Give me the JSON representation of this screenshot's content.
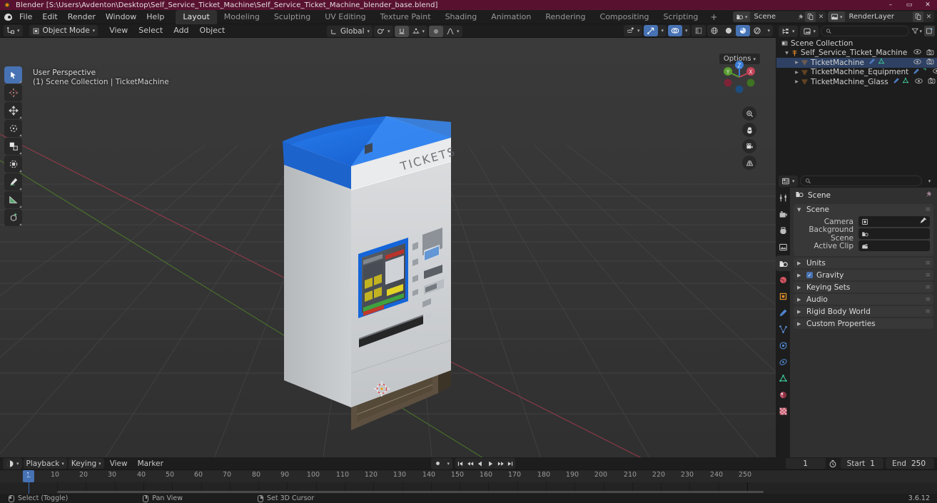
{
  "titlebar": {
    "title": "Blender [S:\\Users\\Avdenton\\Desktop\\Self_Service_Ticket_Machine\\Self_Service_Ticket_Machine_blender_base.blend]",
    "minimize": "–",
    "maximize": "▭",
    "close": "✕"
  },
  "menu": {
    "items": [
      "File",
      "Edit",
      "Render",
      "Window",
      "Help"
    ],
    "workspaces": [
      {
        "label": "Layout",
        "active": true
      },
      {
        "label": "Modeling",
        "active": false
      },
      {
        "label": "Sculpting",
        "active": false
      },
      {
        "label": "UV Editing",
        "active": false
      },
      {
        "label": "Texture Paint",
        "active": false
      },
      {
        "label": "Shading",
        "active": false
      },
      {
        "label": "Animation",
        "active": false
      },
      {
        "label": "Rendering",
        "active": false
      },
      {
        "label": "Compositing",
        "active": false
      },
      {
        "label": "Scripting",
        "active": false
      }
    ],
    "add_workspace": "+",
    "scene_name": "Scene",
    "viewlayer_name": "RenderLayer"
  },
  "viewport": {
    "mode": "Object Mode",
    "menus": [
      "View",
      "Select",
      "Add",
      "Object"
    ],
    "transform_orientation": "Global",
    "overlay_text_line1": "User Perspective",
    "overlay_text_line2": "(1) Scene Collection | TicketMachine",
    "options_label": "Options",
    "gizmo_axes": {
      "x": "X",
      "y": "Y",
      "z": "Z"
    },
    "shading_modes": [
      "wireframe",
      "solid",
      "material-preview",
      "rendered"
    ],
    "active_shading": "material-preview",
    "tools": [
      {
        "name": "tweak-tool",
        "active": true
      },
      {
        "name": "cursor-tool",
        "active": false
      },
      {
        "name": "move-tool",
        "active": false
      },
      {
        "name": "rotate-tool",
        "active": false
      },
      {
        "name": "scale-tool",
        "active": false
      },
      {
        "name": "transform-tool",
        "active": false
      },
      {
        "name": "annotate-tool",
        "active": false
      },
      {
        "name": "measure-tool",
        "active": false
      },
      {
        "name": "add-cube-tool",
        "active": false
      }
    ],
    "nav_buttons": [
      "zoom-icon",
      "pan-hand-icon",
      "camera-icon",
      "perspective-grid-icon"
    ]
  },
  "outliner": {
    "search_placeholder": "",
    "root": "Scene Collection",
    "items": [
      {
        "label": "Self_Service_Ticket_Machine",
        "level": 0,
        "icon": "collection-icon",
        "selected": false,
        "expanded": true,
        "mods": []
      },
      {
        "label": "TicketMachine",
        "level": 1,
        "icon": "mesh-icon",
        "selected": true,
        "expanded": false,
        "mods": [
          "modifier-icon",
          "mesh-data-icon"
        ]
      },
      {
        "label": "TicketMachine_Equipment",
        "level": 1,
        "icon": "mesh-icon",
        "selected": false,
        "expanded": false,
        "mods": [
          "modifier-icon",
          "more-icon"
        ]
      },
      {
        "label": "TicketMachine_Glass",
        "level": 1,
        "icon": "mesh-icon",
        "selected": false,
        "expanded": false,
        "mods": [
          "modifier-icon",
          "mesh-data-icon"
        ]
      }
    ]
  },
  "properties": {
    "search_placeholder": "",
    "breadcrumb": "Scene",
    "tabs": [
      {
        "name": "tool-tab",
        "active": false
      },
      {
        "name": "render-tab",
        "active": false
      },
      {
        "name": "output-tab",
        "active": false
      },
      {
        "name": "view-layer-tab",
        "active": false
      },
      {
        "name": "scene-tab",
        "active": true
      },
      {
        "name": "world-tab",
        "active": false
      },
      {
        "name": "object-tab",
        "active": false
      },
      {
        "name": "modifier-tab",
        "active": false
      },
      {
        "name": "particles-tab",
        "active": false
      },
      {
        "name": "physics-tab",
        "active": false
      },
      {
        "name": "constraints-tab",
        "active": false
      },
      {
        "name": "object-data-tab",
        "active": false
      },
      {
        "name": "material-tab",
        "active": false
      },
      {
        "name": "texture-tab",
        "active": false
      }
    ],
    "panels": [
      {
        "label": "Scene",
        "open": true,
        "checkbox": null
      },
      {
        "label": "Units",
        "open": false,
        "checkbox": null
      },
      {
        "label": "Gravity",
        "open": false,
        "checkbox": true
      },
      {
        "label": "Keying Sets",
        "open": false,
        "checkbox": null
      },
      {
        "label": "Audio",
        "open": false,
        "checkbox": null
      },
      {
        "label": "Rigid Body World",
        "open": false,
        "checkbox": null
      },
      {
        "label": "Custom Properties",
        "open": false,
        "checkbox": null
      }
    ],
    "scene_fields": [
      {
        "label": "Camera",
        "value": "",
        "icon": "camera-icon",
        "right_icon": "eyedropper-icon"
      },
      {
        "label": "Background Scene",
        "value": "",
        "icon": "scene-icon",
        "right_icon": ""
      },
      {
        "label": "Active Clip",
        "value": "",
        "icon": "clip-icon",
        "right_icon": ""
      }
    ]
  },
  "timeline": {
    "editor_type": "timeline-icon",
    "menus": [
      "Playback",
      "Keying",
      "View",
      "Marker"
    ],
    "transport": [
      "jump-start",
      "prev-keyframe",
      "play-reverse",
      "play",
      "next-keyframe",
      "jump-end"
    ],
    "current_frame": "1",
    "start_label": "Start",
    "start_value": "1",
    "end_label": "End",
    "end_value": "250",
    "playhead_frame": "1",
    "ruler_ticks": [
      10,
      20,
      30,
      40,
      50,
      60,
      70,
      80,
      90,
      100,
      110,
      120,
      130,
      140,
      150,
      160,
      170,
      180,
      190,
      200,
      210,
      220,
      230,
      240,
      250
    ]
  },
  "statusbar": {
    "items": [
      {
        "icon": "mouse-left-icon",
        "label": "Select (Toggle)"
      },
      {
        "icon": "mouse-middle-icon",
        "label": "Pan View"
      },
      {
        "icon": "mouse-right-icon",
        "label": "Set 3D Cursor"
      }
    ],
    "version": "3.6.12"
  },
  "colors": {
    "accent_blue": "#4772b3",
    "title_bar": "#58122f",
    "panel_bg": "#303030",
    "editor_bg": "#1d1d1d",
    "machine_blue": "#1a6ae0",
    "machine_body": "#c9cbcd",
    "machine_base": "#5d4f3c"
  }
}
